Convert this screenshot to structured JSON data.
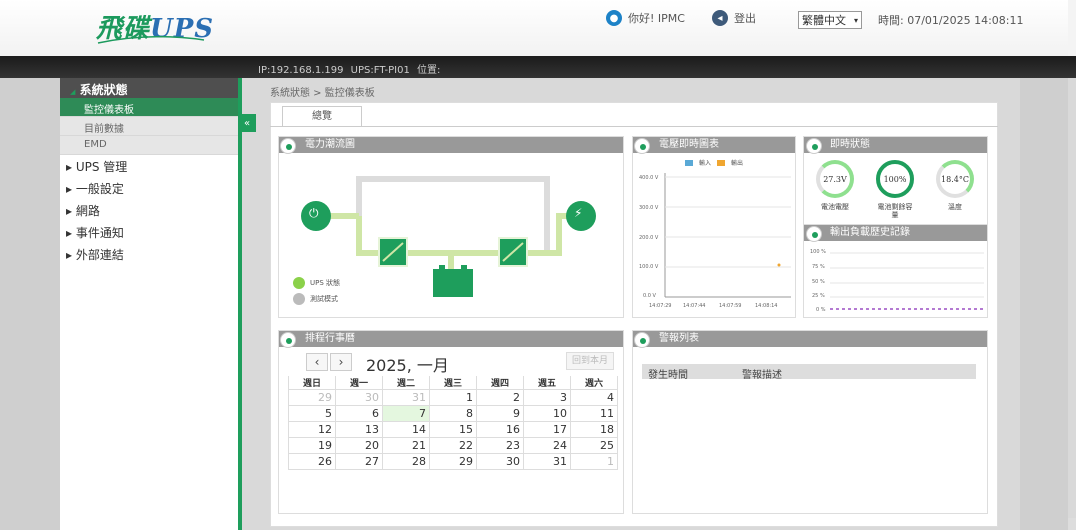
{
  "header": {
    "logo_main": "飛碟",
    "logo_sub": "UPS",
    "user_greeting": "你好! IPMC",
    "logout_label": "登出",
    "language_selected": "繁體中文",
    "time_label": "時間: 07/01/2025 14:08:11"
  },
  "infobar": {
    "text": "IP:192.168.1.199   UPS:FT-PI01   位置:"
  },
  "sidebar": {
    "section_title": "系統狀態",
    "sub_items": [
      {
        "label": "監控儀表板"
      },
      {
        "label": "目前數據"
      },
      {
        "label": "EMD"
      }
    ],
    "items": [
      {
        "label": "▸ UPS 管理"
      },
      {
        "label": "▸ 一般設定"
      },
      {
        "label": "▸ 網路"
      },
      {
        "label": "▸ 事件通知"
      },
      {
        "label": "▸ 外部連結"
      }
    ],
    "collapse_icon": "«"
  },
  "breadcrumb": "系統狀態 > 監控儀表板",
  "tabs": [
    {
      "label": "總覽"
    }
  ],
  "panels": {
    "power_flow": {
      "title": "電力潮流圖",
      "legend": [
        {
          "label": "UPS 狀態",
          "color": "#8bd14a"
        },
        {
          "label": "測試模式",
          "color": "#bbbbbb"
        }
      ]
    },
    "realtime_chart": {
      "title": "電壓即時圖表",
      "legend": [
        {
          "label": "輸入",
          "color": "#5aa9d6"
        },
        {
          "label": "輸出",
          "color": "#f0a630"
        }
      ],
      "y_ticks": [
        "400.0 V",
        "300.0 V",
        "200.0 V",
        "100.0 V",
        "0.0 V"
      ],
      "x_ticks": [
        "14:07:29",
        "14:07:44",
        "14:07:59",
        "14:08:14"
      ]
    },
    "status": {
      "title": "即時狀態",
      "gauges": [
        {
          "value": "27.3V",
          "label": "電池電壓",
          "color": "#8fe08f"
        },
        {
          "value": "100%",
          "label": "電池剩餘容量",
          "color": "#1e9e5c"
        },
        {
          "value": "18.4°C",
          "label": "溫度",
          "color": "#8fe08f"
        }
      ]
    },
    "load_history": {
      "title": "輸出負載歷史記錄",
      "y_ticks": [
        "100 %",
        "75 %",
        "50 %",
        "25 %",
        "0 %"
      ]
    },
    "schedule": {
      "title": "排程行事曆",
      "month_title": "2025, 一月",
      "today_button": "回到本月",
      "weekdays": [
        "週日",
        "週一",
        "週二",
        "週三",
        "週四",
        "週五",
        "週六"
      ],
      "weeks": [
        [
          "29",
          "30",
          "31",
          "1",
          "2",
          "3",
          "4"
        ],
        [
          "5",
          "6",
          "7",
          "8",
          "9",
          "10",
          "11"
        ],
        [
          "12",
          "13",
          "14",
          "15",
          "16",
          "17",
          "18"
        ],
        [
          "19",
          "20",
          "21",
          "22",
          "23",
          "24",
          "25"
        ],
        [
          "26",
          "27",
          "28",
          "29",
          "30",
          "31",
          "1"
        ]
      ]
    },
    "alarms": {
      "title": "警報列表",
      "columns": [
        "發生時間",
        "警報描述"
      ]
    }
  }
}
